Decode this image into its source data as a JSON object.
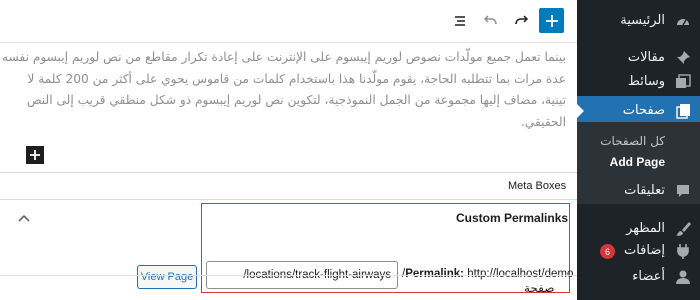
{
  "sidebar": {
    "items": [
      {
        "label": "الرئيسية",
        "icon": "dashboard-icon"
      },
      {
        "label": "مقالات",
        "icon": "pin-icon"
      },
      {
        "label": "وسائط",
        "icon": "media-icon"
      },
      {
        "label": "صفحات",
        "icon": "pages-icon",
        "active": true
      },
      {
        "label": "تعليقات",
        "icon": "comment-icon"
      },
      {
        "label": "المظهر",
        "icon": "brush-icon"
      },
      {
        "label": "إضافات",
        "icon": "plugin-icon",
        "badge": "6"
      },
      {
        "label": "أعضاء",
        "icon": "user-icon"
      }
    ],
    "submenu": [
      {
        "label": "كل الصفحات"
      },
      {
        "label": "Add Page",
        "current": true
      }
    ]
  },
  "editor": {
    "paragraph": "بينما تعمل جميع مولّدات نصوص لوريم إيبسوم على الإنترنت على إعادة تكرار مقاطع من نص لوريم إيبسوم نفسه عدة مرات بما تتطلبه الحاجة، يقوم مولّدنا هذا باستخدام كلمات من قاموس يحوي على أكثر من 200 كلمة لا تينية، مضاف إليها مجموعة من الجمل النموذجية، لتكوين نص لوريم إيبسوم ذو شكل منطقي قريب إلى النص الحقيقي."
  },
  "metaboxes": {
    "title": "Meta Boxes"
  },
  "permalinks": {
    "title": "Custom Permalinks",
    "label": "Permalink:",
    "base_url": "http://localhost/demo",
    "slug_value": "/locations/track-flight-airways",
    "view_button": "View Page"
  },
  "bottom": {
    "label": "صفحة"
  },
  "colors": {
    "sidebar_bg": "#1d2327",
    "accent": "#2271b1",
    "badge": "#d63638",
    "highlight_border": "#d63638"
  }
}
